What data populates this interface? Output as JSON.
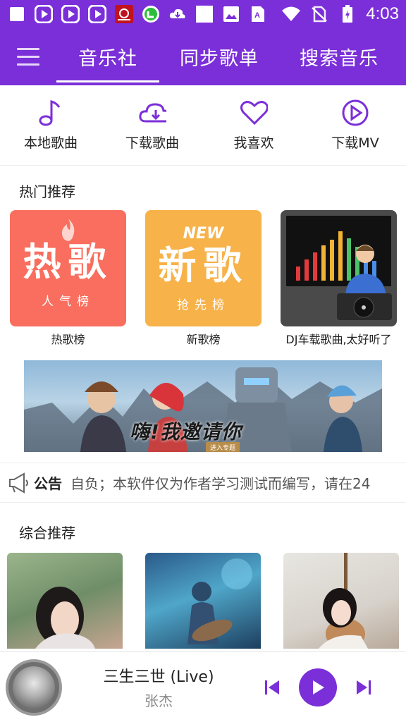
{
  "status_bar": {
    "time": "4:03",
    "icons": [
      "square-icon",
      "play-badge-icon",
      "play-badge-icon",
      "play-badge-icon",
      "music-app-icon",
      "green-app-icon",
      "download-cloud-icon",
      "square-icon",
      "image-icon",
      "font-icon",
      "wifi-icon",
      "no-sim-icon",
      "battery-charging-icon"
    ]
  },
  "header": {
    "tabs": [
      {
        "label": "音乐社"
      },
      {
        "label": "同步歌单"
      },
      {
        "label": "搜索音乐"
      }
    ],
    "active_tab": 0
  },
  "quick_actions": [
    {
      "label": "本地歌曲",
      "icon": "music-note-icon"
    },
    {
      "label": "下载歌曲",
      "icon": "cloud-download-icon"
    },
    {
      "label": "我喜欢",
      "icon": "heart-icon"
    },
    {
      "label": "下载MV",
      "icon": "play-circle-icon"
    }
  ],
  "hot": {
    "title": "热门推荐",
    "items": [
      {
        "cover_big": "热歌",
        "cover_small": "人气榜",
        "caption": "热歌榜"
      },
      {
        "cover_tag": "NEW",
        "cover_big": "新歌",
        "cover_small": "抢先榜",
        "caption": "新歌榜"
      },
      {
        "caption": "DJ车载歌曲,太好听了"
      }
    ]
  },
  "banner": {
    "headline": "嗨!我邀请你",
    "button": "进入专题"
  },
  "notice": {
    "label": "公告",
    "text": "自负；本软件仅为作者学习测试而编写，请在24"
  },
  "recommend": {
    "title": "综合推荐"
  },
  "player": {
    "title": "三生三世 (Live)",
    "artist": "张杰"
  },
  "colors": {
    "brand": "#7b2fd8",
    "hot_cover": "#f96e5e",
    "new_cover": "#f7b24a"
  }
}
